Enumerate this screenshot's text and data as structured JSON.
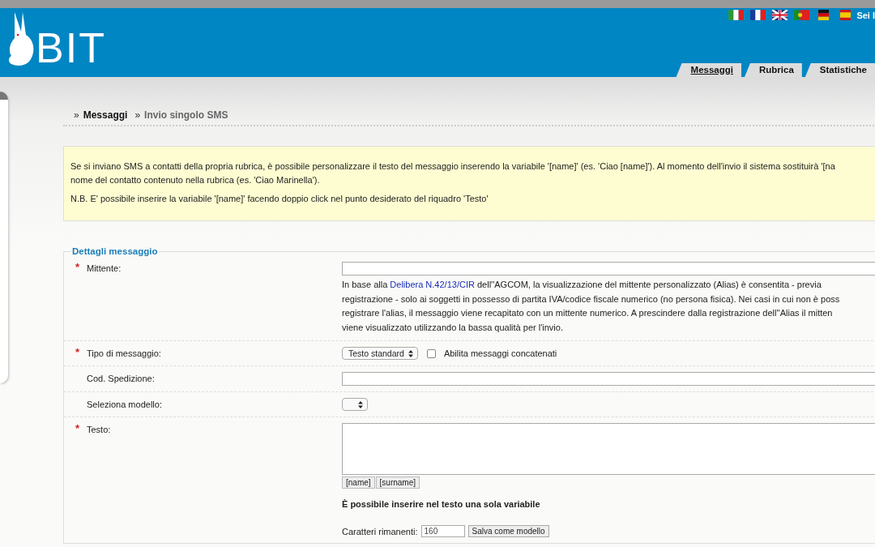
{
  "header": {
    "logo": "BIT",
    "user_text": "Sei l",
    "tabs": [
      {
        "label": "Messaggi",
        "selected": true
      },
      {
        "label": "Rubrica",
        "selected": false
      },
      {
        "label": "Statistiche",
        "selected": false
      }
    ]
  },
  "breadcrumb": [
    {
      "separator": "»",
      "label": "Messaggi",
      "current": false
    },
    {
      "separator": "»",
      "label": "Invio singolo SMS",
      "current": true
    }
  ],
  "notice": {
    "paragraphs": [
      [
        "Se si inviano SMS a contatti della propria rubrica, è possibile personalizzare il testo del messaggio inserendo la variabile '[name]' (es. 'Ciao [name]'). Al momento dell'invio il sistema sostituirà '[na",
        "nome del contatto contenuto nella rubrica (es. 'Ciao Marinella')."
      ],
      [
        "N.B. E' possibile inserire la variabile '[name]' facendo doppio click nel punto desiderato del riquadro 'Testo'"
      ]
    ]
  },
  "form": {
    "legend": "Dettagli messaggio",
    "rows": [
      {
        "kind": "text",
        "label": "Mittente:",
        "mark": "*",
        "help": [
          [
            {
              "text": "In base alla "
            },
            {
              "text": "Delibera N.42/13/CIR",
              "kind": "link"
            },
            {
              "text": " dell''AGCOM, la visualizzazione del mittente personalizzato (Alias) è consentita - previa"
            }
          ],
          [
            {
              "text": "registrazione - solo ai soggetti in possesso di partita IVA/codice fiscale numerico (no persona fisica). Nei casi in cui non è poss"
            }
          ],
          [
            {
              "text": "registrare l'alias, il messaggio viene recapitato con un mittente numerico. A prescindere dalla registrazione dell''Alias il mitten"
            }
          ],
          [
            {
              "text": "viene visualizzato utilizzando la bassa qualità per l'invio."
            }
          ]
        ]
      },
      {
        "kind": "select-checkbox",
        "label": "Tipo di messaggio:",
        "mark": "*",
        "select": "Testo standard",
        "checkbox": {
          "label": "Abilita messaggi concatenati",
          "checked": false
        }
      },
      {
        "kind": "text",
        "label": "Cod. Spedizione:"
      },
      {
        "kind": "select",
        "label": "Seleziona modello:"
      },
      {
        "kind": "textarea",
        "label": "Testo:",
        "mark": "*",
        "variables": [
          "[name]",
          "[surname]"
        ],
        "note": "È possibile inserire nel testo una sola variabile",
        "counter_label": "Caratteri rimanenti:",
        "counter_value": "160",
        "save_button": "Salva come modello"
      }
    ]
  }
}
